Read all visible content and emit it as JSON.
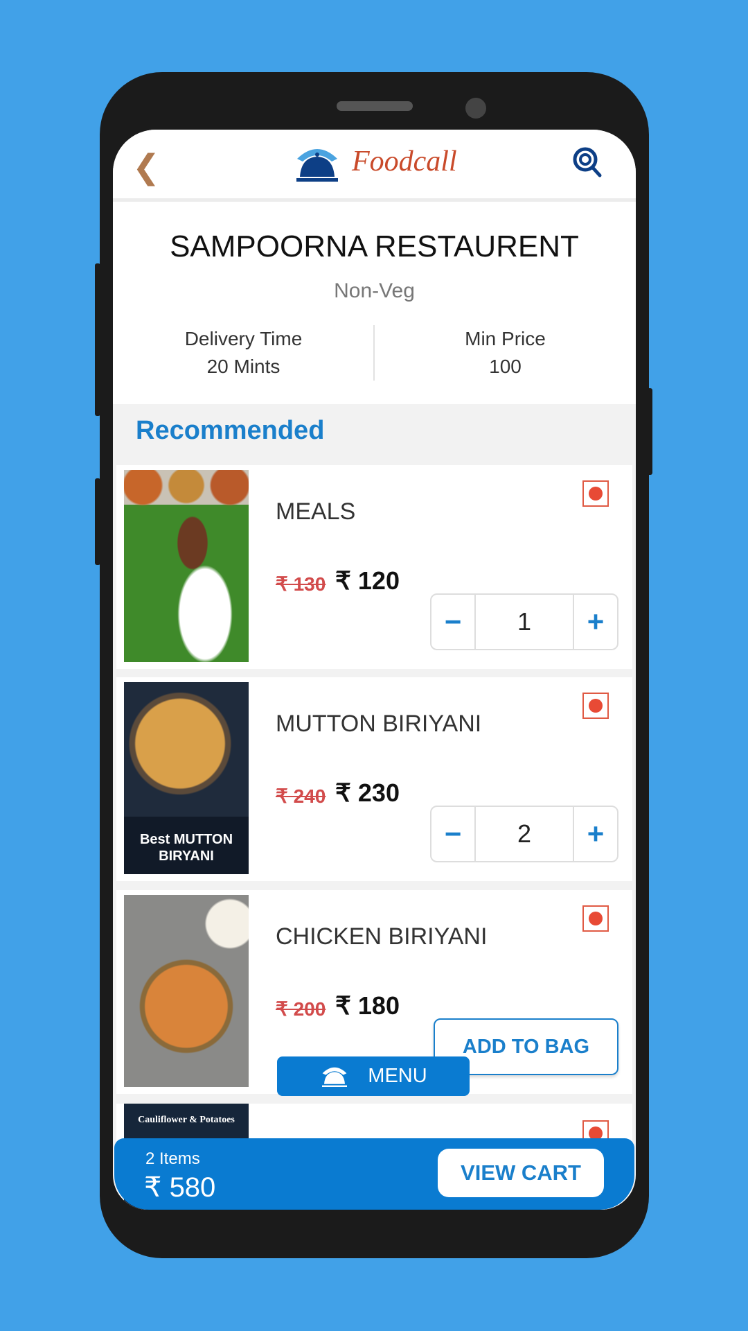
{
  "header": {
    "brand": "Foodcall",
    "back_icon": "chevron-left-icon",
    "search_icon": "search-icon"
  },
  "restaurant": {
    "name": "SAMPOORNA RESTAURENT",
    "type": "Non-Veg",
    "delivery_label": "Delivery Time",
    "delivery_value": "20 Mints",
    "min_price_label": "Min Price",
    "min_price_value": "100"
  },
  "section_title": "Recommended",
  "items": [
    {
      "name": "MEALS",
      "old_price": "₹ 130",
      "price": "₹ 120",
      "qty": "1",
      "image_text": ""
    },
    {
      "name": "MUTTON BIRIYANI",
      "old_price": "₹ 240",
      "price": "₹ 230",
      "qty": "2",
      "image_text": "Best MUTTON BIRYANI"
    },
    {
      "name": "CHICKEN BIRIYANI",
      "old_price": "₹ 200",
      "price": "₹ 180",
      "action": "ADD TO BAG"
    },
    {
      "image_text": "Cauliflower & Potatoes"
    }
  ],
  "stepper": {
    "minus": "−",
    "plus": "+"
  },
  "menu_button": "MENU",
  "cart": {
    "items": "2 Items",
    "total": "₹ 580",
    "button": "VIEW CART"
  },
  "colors": {
    "accent": "#0a7bd1",
    "nonveg": "#e84a35",
    "background": "#41a1e8"
  }
}
